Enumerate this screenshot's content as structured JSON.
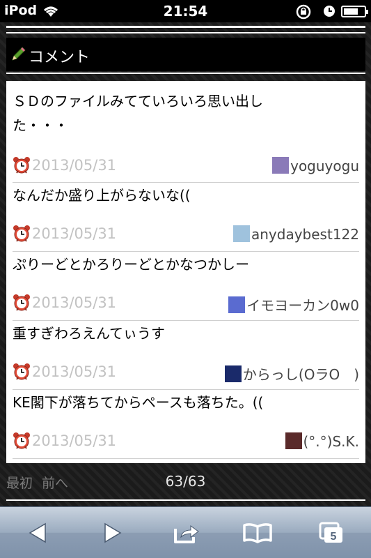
{
  "statusbar": {
    "carrier": "iPod",
    "time": "21:54",
    "battery_level": 0.7
  },
  "section": {
    "title": "コメント",
    "icon": "pencil-icon"
  },
  "comments": [
    {
      "text": "ＳＤのファイルみてていろいろ思い出した・・・",
      "date": "2013/05/31",
      "user": "yoguyogu",
      "avatar_color": "#8a7ab8"
    },
    {
      "text": "なんだか盛り上がらないな((",
      "date": "2013/05/31",
      "user": "anydaybest122",
      "avatar_color": "#9fc2dd"
    },
    {
      "text": "ぷりーどとかろりーどとかなつかしー",
      "date": "2013/05/31",
      "user": "イモヨーカン0w0",
      "avatar_color": "#5a6bd0"
    },
    {
      "text": "重すぎわろえんてぃうす",
      "date": "2013/05/31",
      "user": "からっし(OラO　)",
      "avatar_color": "#1a2a6a"
    },
    {
      "text": "KE閣下が落ちてからペースも落ちた。((",
      "date": "2013/05/31",
      "user": "(°.°)S.K.",
      "avatar_color": "#5a2a2a"
    }
  ],
  "pager": {
    "first": "最初",
    "prev": "前へ",
    "count": "63/63"
  },
  "toolbar": {
    "back": "back-arrow-icon",
    "forward": "forward-arrow-icon",
    "share": "share-icon",
    "bookmarks": "bookmarks-icon",
    "tabs_count": "5"
  }
}
